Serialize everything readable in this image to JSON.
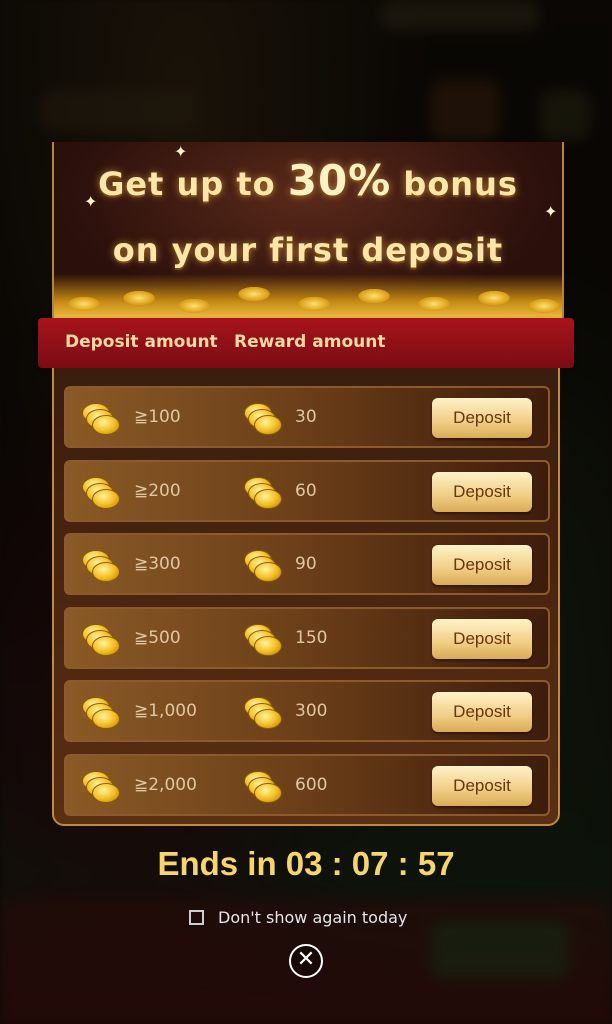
{
  "banner": {
    "line1_prefix": "Get up to ",
    "line1_highlight": "30%",
    "line1_suffix": " bonus",
    "line2": "on your first deposit"
  },
  "header": {
    "deposit_label": "Deposit amount",
    "reward_label": "Reward amount"
  },
  "rows": [
    {
      "deposit": "≧100",
      "reward": "30",
      "button": "Deposit"
    },
    {
      "deposit": "≧200",
      "reward": "60",
      "button": "Deposit"
    },
    {
      "deposit": "≧300",
      "reward": "90",
      "button": "Deposit"
    },
    {
      "deposit": "≧500",
      "reward": "150",
      "button": "Deposit"
    },
    {
      "deposit": "≧1,000",
      "reward": "300",
      "button": "Deposit"
    },
    {
      "deposit": "≧2,000",
      "reward": "600",
      "button": "Deposit"
    }
  ],
  "timer": {
    "text": "Ends in 03 : 07 : 57"
  },
  "footer": {
    "dont_show_label": "Don't show again today",
    "close_icon": "close-circle-icon"
  },
  "colors": {
    "ribbon": "#a9141c",
    "timer": "#f6d66a",
    "button": "#f0cd83"
  }
}
